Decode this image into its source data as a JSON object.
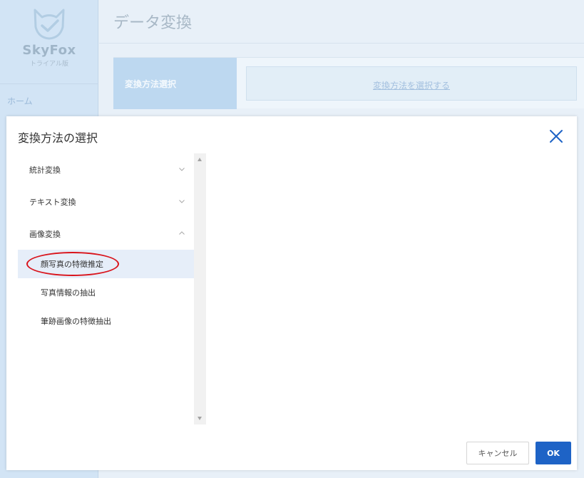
{
  "app": {
    "logo_text": "SkyFox",
    "logo_subtitle": "トライアル版",
    "nav_home": "ホーム",
    "page_title": "データ変換",
    "form": {
      "label": "変換方法選択",
      "link": "変換方法を選択する"
    }
  },
  "icons": {
    "logo": "fox-check-icon",
    "close": "close-icon",
    "expand": "chevron-down-icon",
    "collapse": "chevron-up-icon"
  },
  "colors": {
    "primary": "#1e63c6",
    "highlight_ring": "#d9141c",
    "selected_row": "#e6eef9",
    "close_icon": "#1e63c6"
  },
  "modal": {
    "title": "変換方法の選択",
    "tree": [
      {
        "label": "統計変換",
        "expanded": false
      },
      {
        "label": "テキスト変換",
        "expanded": false
      },
      {
        "label": "画像変換",
        "expanded": true,
        "children": [
          {
            "label": "顔写真の特徴推定",
            "selected": true
          },
          {
            "label": "写真情報の抽出",
            "selected": false
          },
          {
            "label": "筆跡画像の特徴抽出",
            "selected": false
          }
        ]
      }
    ],
    "cancel_label": "キャンセル",
    "ok_label": "OK"
  }
}
